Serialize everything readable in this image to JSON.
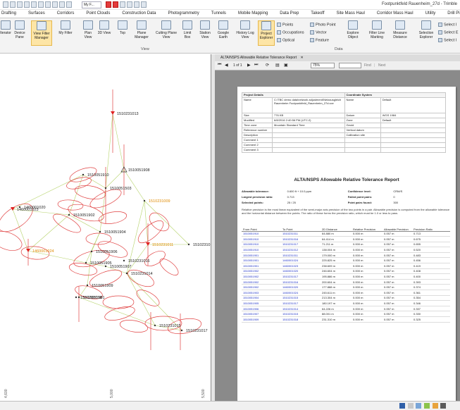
{
  "window": {
    "title": "Footpunktfeld Rauenheim_27d - Trimble",
    "doc_selector": "My F..."
  },
  "ribbon_tabs": [
    "Drafting",
    "Surfaces",
    "Corridors",
    "Point Clouds",
    "Construction Data",
    "Photogrammetry",
    "Tunnels",
    "Mobile Mapping",
    "Data Prep",
    "Takeoff",
    "Site Mass Haul",
    "Corridor Mass Haul",
    "Utility",
    "Drill Pile C"
  ],
  "ribbon": {
    "buttons": [
      {
        "label": "Iterator",
        "icon": "iterator-icon",
        "active": false
      },
      {
        "label": "Device Pane",
        "icon": "device-pane-icon",
        "active": false
      },
      {
        "label": "View Filter Manager",
        "icon": "view-filter-icon",
        "active": true
      },
      {
        "label": "My Filter",
        "icon": "filter-icon",
        "active": false
      },
      {
        "label": "Plan View",
        "icon": "plan-view-icon",
        "active": false
      },
      {
        "label": "3D View",
        "icon": "cube-icon",
        "active": false
      },
      {
        "label": "Top",
        "icon": "top-view-icon",
        "active": false
      },
      {
        "label": "Plane Manager",
        "icon": "plane-manager-icon",
        "active": false
      },
      {
        "label": "Cutting Plane View",
        "icon": "cutting-plane-icon",
        "active": false
      },
      {
        "label": "Limit Box",
        "icon": "limit-box-icon",
        "active": false
      },
      {
        "label": "Station View",
        "icon": "station-view-icon",
        "active": false
      },
      {
        "label": "Google Earth",
        "icon": "globe-icon",
        "active": false
      },
      {
        "label": "History Log View",
        "icon": "history-icon",
        "active": false
      },
      {
        "label": "Project Explorer",
        "icon": "project-explorer-icon",
        "active": true
      },
      {
        "label": "Explore Object",
        "icon": "explore-object-icon",
        "active": false
      },
      {
        "label": "Filter Line Marking",
        "icon": "filter-line-icon",
        "active": false
      },
      {
        "label": "Measure Distance",
        "icon": "measure-icon",
        "active": false
      },
      {
        "label": "Selection Explorer",
        "icon": "selection-explorer-icon",
        "active": false
      }
    ],
    "small_items": [
      "Points",
      "Occupations",
      "Optical",
      "Photo Point",
      "Vector",
      "Feature",
      "Select I",
      "Select E",
      "Select I"
    ],
    "groups": [
      "View",
      "Data"
    ]
  },
  "plan": {
    "axis_labels": [
      "4,600",
      "5,000",
      "5,500"
    ],
    "points": [
      {
        "id": "1510231013",
        "color": "#222"
      },
      {
        "id": "1510051908",
        "color": "#222"
      },
      {
        "id": "1510231009",
        "color": "#e08a00"
      },
      {
        "id": "1510051503",
        "color": "#222"
      },
      {
        "id": "1510051910",
        "color": "#222"
      },
      {
        "id": "1510051902",
        "color": "#222"
      },
      {
        "id": "1510051904",
        "color": "#222"
      },
      {
        "id": "1510051906",
        "color": "#222"
      },
      {
        "id": "1510051909",
        "color": "#222"
      },
      {
        "id": "1460001023",
        "color": "#222"
      },
      {
        "id": "1460001020",
        "color": "#222"
      },
      {
        "id": "1460001024",
        "color": "#e08a00"
      },
      {
        "id": "1510051905",
        "color": "#222"
      },
      {
        "id": "1510051907",
        "color": "#222"
      },
      {
        "id": "1510051901",
        "color": "#222"
      },
      {
        "id": "1510231011",
        "color": "#e08a00"
      },
      {
        "id": "1510231014",
        "color": "#222"
      },
      {
        "id": "1510231018",
        "color": "#222"
      },
      {
        "id": "1510231015",
        "color": "#222"
      },
      {
        "id": "1510231017",
        "color": "#222"
      },
      {
        "id": "1510231016",
        "color": "#222"
      },
      {
        "id": "1510231012",
        "color": "#222"
      }
    ]
  },
  "report": {
    "tab_label": "ALTA/NSPS Allowable Relative Tolerance Report",
    "zoom": "75%",
    "find_label": "Find",
    "next_label": "Next",
    "page_nav": "1 of 1",
    "project_header": "Project Details",
    "coord_header": "Coordinate System",
    "project_rows": [
      [
        "Name",
        "C:\\TBC demo data\\network adjustment\\Netzausgleich Rauenheim Footpunktfeld_Rauenheim_27d.vce"
      ],
      [
        "Size",
        "776 KB"
      ],
      [
        "Modified",
        "6/8/2016 2:40:56 PM (UTC:2)"
      ],
      [
        "Time zone",
        "Mountain Standard Time"
      ],
      [
        "Reference number",
        ""
      ],
      [
        "Description",
        ""
      ],
      [
        "Comment 1",
        ""
      ],
      [
        "Comment 2",
        ""
      ],
      [
        "Comment 3",
        ""
      ]
    ],
    "coord_rows": [
      [
        "Name",
        "Default"
      ],
      [
        "Datum",
        "WGS 1984"
      ],
      [
        "Zone",
        "Default"
      ],
      [
        "Geoid",
        ""
      ],
      [
        "Vertical datum",
        ""
      ],
      [
        "Calibration site",
        ""
      ]
    ],
    "title": "ALTA/NSPS Allowable Relative Tolerance Report",
    "summary": [
      [
        "Allowable tolerance:",
        "0.600 ft + 10.0 ppm",
        "Confidence level:",
        "CRM/S"
      ],
      [
        "Largest precision ratio:",
        "0.713",
        "Failed point pairs:",
        "0"
      ],
      [
        "Selected points:",
        "25 / 25",
        "Point pairs found:",
        "300"
      ]
    ],
    "description": "Relative precision is the most linear equivalent of the semi-major axis precision of the two points in a pair. Allowable precision is computed from the allowable tolerance and the horizontal distance between the points. The ratio of these forms the precision ratio, which must be 1.0 or less to pass.",
    "columns": [
      "From Point",
      "To Point",
      "2D Distance",
      "Relative Precision",
      "Allowable Precision",
      "Precision Ratio"
    ],
    "rows": [
      [
        "1510051910",
        "1510231011",
        "64.880 m",
        "0.000 m",
        "0.057 m",
        "0.713"
      ],
      [
        "1510051910",
        "1510231016",
        "64.414 m",
        "0.000 m",
        "0.057 m",
        "0.675"
      ],
      [
        "1510051910",
        "1510231017",
        "71.211 m",
        "0.000 m",
        "0.057 m",
        "0.655"
      ],
      [
        "1510051910",
        "1510231012",
        "138.004 m",
        "0.000 m",
        "0.057 m",
        "0.520"
      ],
      [
        "1510051901",
        "1510231011",
        "179.000 m",
        "0.000 m",
        "0.057 m",
        "0.483"
      ],
      [
        "1510051901",
        "1460001024",
        "225.825 m",
        "0.000 m",
        "0.057 m",
        "0.456"
      ],
      [
        "1510051901",
        "1460001023",
        "238.609 m",
        "0.000 m",
        "0.057 m",
        "0.419"
      ],
      [
        "1510051902",
        "1460001020",
        "246.604 m",
        "0.000 m",
        "0.057 m",
        "0.408"
      ],
      [
        "1510051902",
        "1510231017",
        "195.886 m",
        "0.000 m",
        "0.057 m",
        "0.400"
      ],
      [
        "1510051902",
        "1510231016",
        "200.604 m",
        "0.000 m",
        "0.057 m",
        "0.393"
      ],
      [
        "1510051902",
        "1460001020",
        "177.888 m",
        "0.000 m",
        "0.057 m",
        "0.374"
      ],
      [
        "1510051903",
        "1460001024",
        "245.611 m",
        "0.000 m",
        "0.057 m",
        "0.361"
      ],
      [
        "1510051904",
        "1510231015",
        "213.304 m",
        "0.000 m",
        "0.057 m",
        "0.354"
      ],
      [
        "1510051905",
        "1510231017",
        "180.197 m",
        "0.000 m",
        "0.057 m",
        "0.346"
      ],
      [
        "1510051906",
        "1510231014",
        "64.226 m",
        "0.000 m",
        "0.057 m",
        "0.337"
      ],
      [
        "1510051907",
        "1510231015",
        "88.001 m",
        "0.000 m",
        "0.057 m",
        "0.330"
      ],
      [
        "1510051909",
        "1510231018",
        "231.310 m",
        "0.000 m",
        "0.057 m",
        "0.325"
      ]
    ],
    "page_number": "1"
  }
}
